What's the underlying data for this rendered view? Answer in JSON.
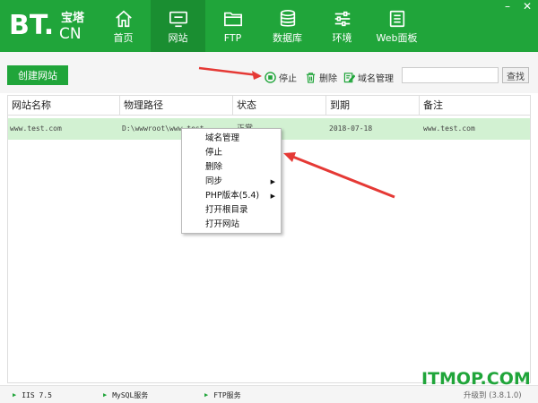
{
  "logo": {
    "bt": "BT",
    "dot": ".",
    "cn_top": "宝塔",
    "cn_bottom": "CN"
  },
  "nav": {
    "items": [
      {
        "label": "首页",
        "icon": "home-icon"
      },
      {
        "label": "网站",
        "icon": "monitor-icon",
        "active": true
      },
      {
        "label": "FTP",
        "icon": "folder-icon"
      },
      {
        "label": "数据库",
        "icon": "database-icon"
      },
      {
        "label": "环境",
        "icon": "sliders-icon"
      },
      {
        "label": "Web面板",
        "icon": "list-icon"
      }
    ]
  },
  "window": {
    "minimize": "–",
    "close": "✕"
  },
  "toolbar": {
    "create_label": "创建网站",
    "stop_label": "停止",
    "delete_label": "删除",
    "domain_label": "域名管理",
    "search_value": "",
    "search_button": "查找"
  },
  "table": {
    "headers": [
      "网站名称",
      "物理路径",
      "状态",
      "到期",
      "备注"
    ],
    "rows": [
      {
        "name": "www.test.com",
        "path": "D:\\wwwroot\\www.test",
        "status": "正常",
        "expire": "2018-07-18",
        "note": "www.test.com"
      }
    ]
  },
  "context_menu": {
    "items": [
      {
        "label": "域名管理",
        "submenu": false
      },
      {
        "label": "停止",
        "submenu": false
      },
      {
        "label": "删除",
        "submenu": false
      },
      {
        "label": "同步",
        "submenu": true
      },
      {
        "label": "PHP版本(5.4)",
        "submenu": true
      },
      {
        "label": "打开根目录",
        "submenu": false
      },
      {
        "label": "打开网站",
        "submenu": false
      }
    ],
    "submenu_glyph": "▶"
  },
  "statusbar": {
    "services": [
      {
        "label": "IIS 7.5"
      },
      {
        "label": "MySQL服务"
      },
      {
        "label": "FTP服务"
      }
    ],
    "tri_glyph": "▶",
    "version": "升级到 (3.8.1.0)"
  },
  "watermark": "ITMOP.COM",
  "colors": {
    "brand": "#20a53a",
    "brand_dark": "#1a8e31",
    "row_selected": "#d2f1d2",
    "arrow": "#e53935"
  }
}
